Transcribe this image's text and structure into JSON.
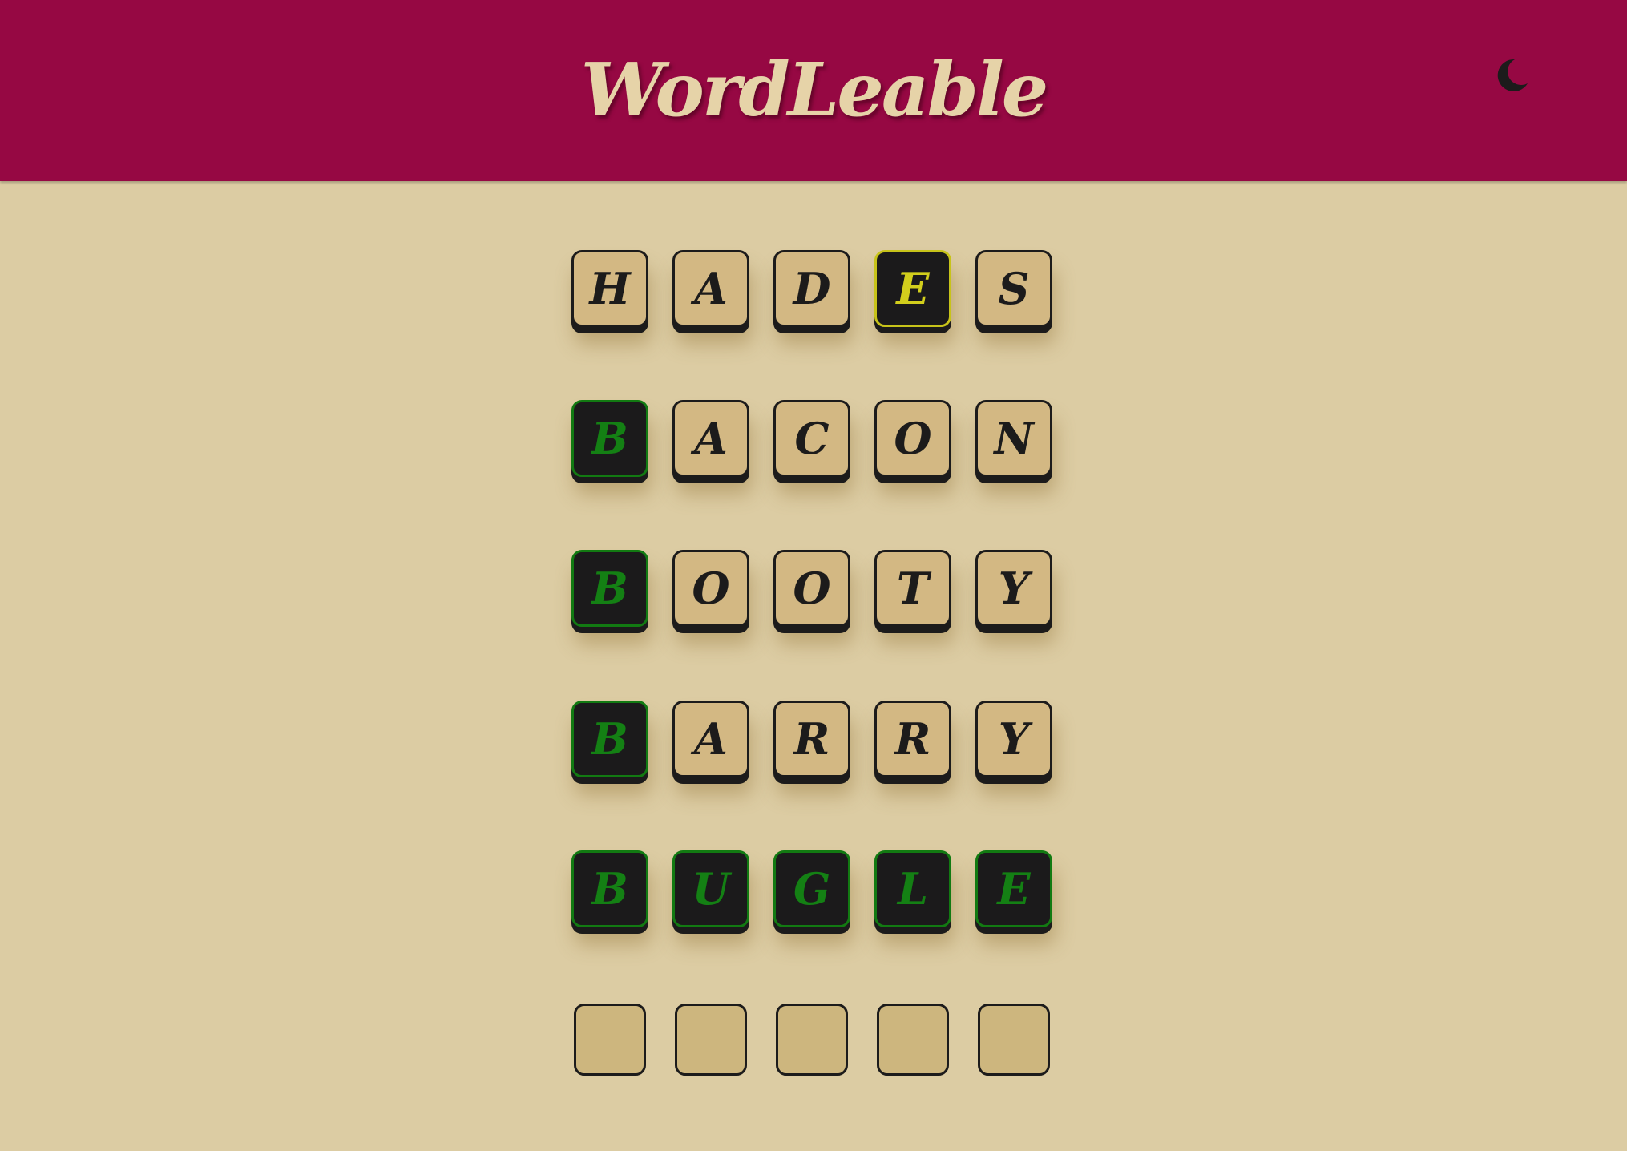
{
  "header": {
    "title": "WordLeable",
    "theme_icon": "moon-icon",
    "background": "#960843"
  },
  "colors": {
    "page_bg": "#dccca3",
    "tile_bg": "#d3b883",
    "correct": "#148014",
    "present": "#d2ce1c",
    "tile_dark": "#1b1a1b"
  },
  "board": {
    "rows": [
      {
        "letters": [
          "H",
          "A",
          "D",
          "E",
          "S"
        ],
        "states": [
          "absent",
          "absent",
          "absent",
          "present",
          "absent"
        ]
      },
      {
        "letters": [
          "B",
          "A",
          "C",
          "O",
          "N"
        ],
        "states": [
          "correct",
          "absent",
          "absent",
          "absent",
          "absent"
        ]
      },
      {
        "letters": [
          "B",
          "O",
          "O",
          "T",
          "Y"
        ],
        "states": [
          "correct",
          "absent",
          "absent",
          "absent",
          "absent"
        ]
      },
      {
        "letters": [
          "B",
          "A",
          "R",
          "R",
          "Y"
        ],
        "states": [
          "correct",
          "absent",
          "absent",
          "absent",
          "absent"
        ]
      },
      {
        "letters": [
          "B",
          "U",
          "G",
          "L",
          "E"
        ],
        "states": [
          "correct",
          "correct",
          "correct",
          "correct",
          "correct"
        ]
      },
      {
        "letters": [
          "",
          "",
          "",
          "",
          ""
        ],
        "states": [
          "empty",
          "empty",
          "empty",
          "empty",
          "empty"
        ]
      }
    ]
  }
}
